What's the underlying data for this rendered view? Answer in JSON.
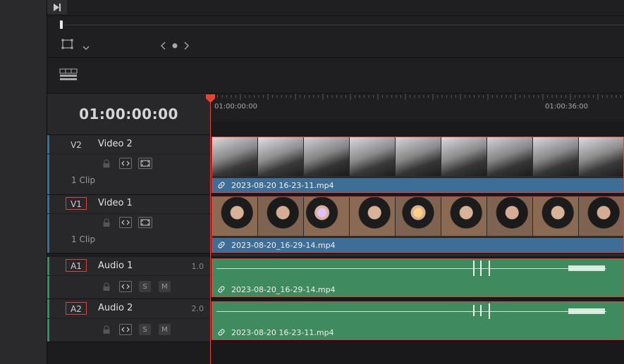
{
  "timecode": "01:00:00:00",
  "ruler": {
    "labels": [
      "01:00:00:00",
      "01:00:36:00"
    ]
  },
  "colors": {
    "video_track": "#3e6d96",
    "audio_track": "#3f8a5e",
    "selection": "#d9453d",
    "playhead": "#e0453a"
  },
  "tracks": {
    "v2": {
      "id": "V2",
      "name": "Video 2",
      "clips": "1 Clip"
    },
    "v1": {
      "id": "V1",
      "name": "Video 1",
      "clips": "1 Clip"
    },
    "a1": {
      "id": "A1",
      "name": "Audio 1",
      "gain": "1.0",
      "solo": "S",
      "mute": "M"
    },
    "a2": {
      "id": "A2",
      "name": "Audio 2",
      "gain": "2.0",
      "solo": "S",
      "mute": "M"
    }
  },
  "clips": {
    "v2": "2023-08-20 16-23-11.mp4",
    "v1": "2023-08-20_16-29-14.mp4",
    "a1": "2023-08-20_16-29-14.mp4",
    "a2": "2023-08-20 16-23-11.mp4"
  },
  "icons": {
    "play": "play-to-end-icon",
    "transform": "transform-icon",
    "chevron": "chevron-down-icon",
    "nav": "prev-next-icon",
    "layout": "timeline-layout-icon",
    "lock": "lock-icon",
    "auto_select": "auto-select-icon",
    "video_toggle": "video-toggle-icon",
    "link": "link-icon"
  }
}
